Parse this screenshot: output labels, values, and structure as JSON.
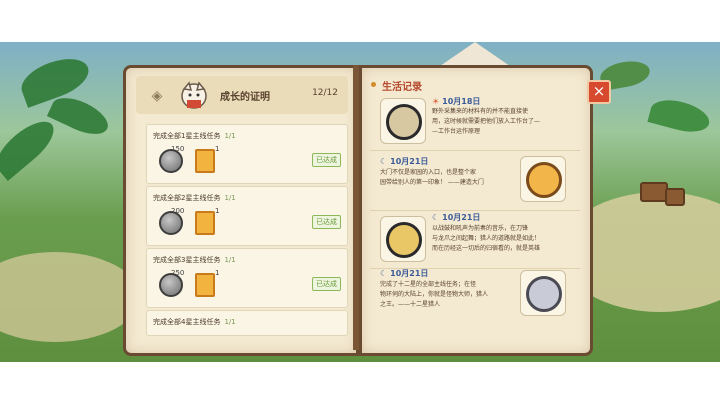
{
  "left_page": {
    "title": "成长的证明",
    "count": "12/12",
    "tasks": [
      {
        "title": "完成全部1星主线任务",
        "progress": "1/1",
        "coin": "150",
        "ticket": "1",
        "status": "已达成"
      },
      {
        "title": "完成全部2星主线任务",
        "progress": "1/1",
        "coin": "200",
        "ticket": "1",
        "status": "已达成"
      },
      {
        "title": "完成全部3星主线任务",
        "progress": "1/1",
        "coin": "250",
        "ticket": "1",
        "status": "已达成"
      },
      {
        "title": "完成全部4星主线任务",
        "progress": "1/1"
      }
    ]
  },
  "right_page": {
    "title": "生活记录",
    "entries": [
      {
        "date": "10月18日",
        "icon": "sun",
        "lines": [
          "野外采集来的材料有的并不能直接使",
          "用，这时候就需要把他们放入工作台了—",
          "—工作台运作原理"
        ]
      },
      {
        "date": "10月21日",
        "icon": "moon",
        "lines": [
          "大门不仅是家园的入口，也是整个家",
          "园带给别人的第一印象！ ——建造大门"
        ]
      },
      {
        "date": "10月21日",
        "icon": "moon",
        "lines": [
          "以战鼓和吼声为前奏的音乐，在刀锋",
          "与龙爪之间起舞；猎人的道路就是如此！",
          "而在历经这一切后的归宿看的，就是英雄"
        ]
      },
      {
        "date": "10月21日",
        "icon": "moon",
        "lines": [
          "完成了十二星的全部主线任务；在怪",
          "物环伺的大陆上，你就是怪物大师，猎人",
          "之王。——十二星猎人"
        ]
      }
    ]
  },
  "icons": {
    "sun": "☀",
    "moon": "☾"
  },
  "close_label": "×"
}
